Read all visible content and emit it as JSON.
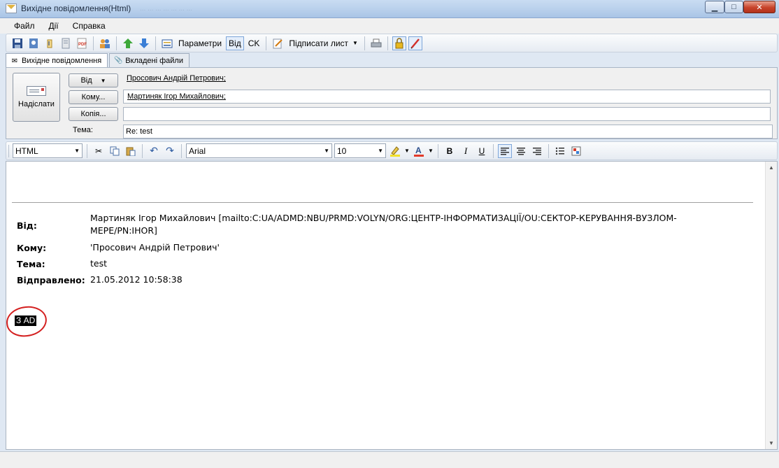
{
  "window": {
    "title": "Вихідне повідомлення(Html)",
    "ghost_tabs": "...  ...   ...  ...   ...   ...   ..."
  },
  "menu": [
    "Файл",
    "Дії",
    "Справка"
  ],
  "toolbar": {
    "params_label": "Параметри",
    "vid_label": "Від",
    "ck_label": "CK",
    "sign_label": "Підписати лист"
  },
  "tabs": [
    {
      "label": "Вихідне повідомлення",
      "icon": "envelope-icon"
    },
    {
      "label": "Вкладені файли",
      "icon": "paperclip-icon"
    }
  ],
  "header": {
    "send_label": "Надіслати",
    "from_btn": "Від",
    "to_btn": "Кому...",
    "cc_btn": "Копія...",
    "subject_label": "Тема:",
    "from_value": "Просович Андрій Петрович;",
    "to_value": "Мартиняк Ігор Михайлович;",
    "cc_value": "",
    "subject_value": "Re: test"
  },
  "format": {
    "mode": "HTML",
    "font": "Arial",
    "size": "10"
  },
  "message": {
    "from_label": "Від:",
    "from_value": "Мартиняк Ігор Михайлович [mailto:C:UA/ADMD:NBU/PRMD:VOLYN/ORG:ЦЕНТР-ІНФОРМАТИЗАЦІЇ/OU:СЕКТОР-КЕРУВАННЯ-ВУЗЛОМ-МЕРЕ/PN:IHOR]",
    "to_label": "Кому:",
    "to_value": "'Просович Андрій Петрович'",
    "subject_label": "Тема:",
    "subject_value": "test",
    "sent_label": "Відправлено:",
    "sent_value": "21.05.2012 10:58:38",
    "highlighted_text": "З AD"
  }
}
